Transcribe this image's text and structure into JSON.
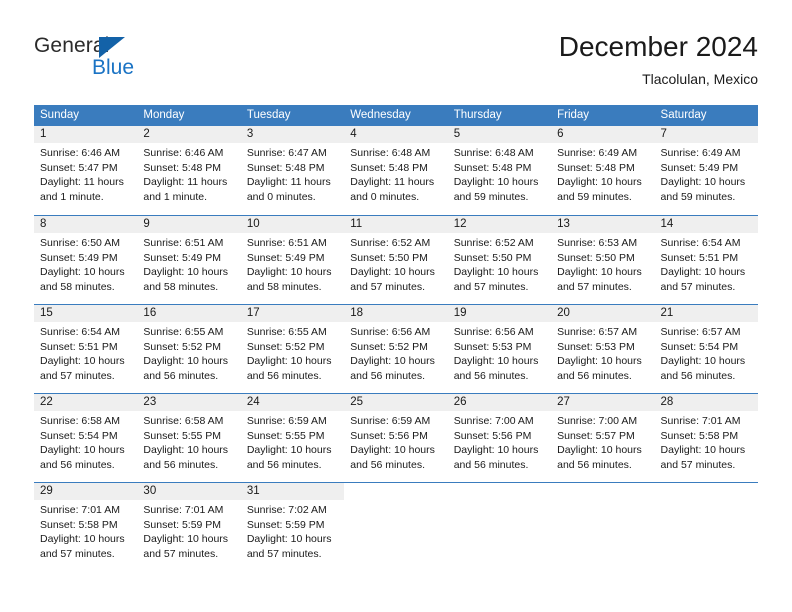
{
  "brand": {
    "name_part1": "General",
    "name_part2": "Blue",
    "triangle_color": "#1362a8",
    "blue_color": "#1a73c4"
  },
  "header": {
    "title": "December 2024",
    "subtitle": "Tlacolulan, Mexico"
  },
  "theme": {
    "header_bg": "#3a7cbe",
    "daynum_bg": "#efefef",
    "text": "#1a1a1a"
  },
  "weekdays": [
    {
      "label": "Sunday"
    },
    {
      "label": "Monday"
    },
    {
      "label": "Tuesday"
    },
    {
      "label": "Wednesday"
    },
    {
      "label": "Thursday"
    },
    {
      "label": "Friday"
    },
    {
      "label": "Saturday"
    }
  ],
  "weeks": [
    {
      "days": [
        {
          "num": "1",
          "sunrise": "Sunrise: 6:46 AM",
          "sunset": "Sunset: 5:47 PM",
          "daylight1": "Daylight: 11 hours",
          "daylight2": "and 1 minute."
        },
        {
          "num": "2",
          "sunrise": "Sunrise: 6:46 AM",
          "sunset": "Sunset: 5:48 PM",
          "daylight1": "Daylight: 11 hours",
          "daylight2": "and 1 minute."
        },
        {
          "num": "3",
          "sunrise": "Sunrise: 6:47 AM",
          "sunset": "Sunset: 5:48 PM",
          "daylight1": "Daylight: 11 hours",
          "daylight2": "and 0 minutes."
        },
        {
          "num": "4",
          "sunrise": "Sunrise: 6:48 AM",
          "sunset": "Sunset: 5:48 PM",
          "daylight1": "Daylight: 11 hours",
          "daylight2": "and 0 minutes."
        },
        {
          "num": "5",
          "sunrise": "Sunrise: 6:48 AM",
          "sunset": "Sunset: 5:48 PM",
          "daylight1": "Daylight: 10 hours",
          "daylight2": "and 59 minutes."
        },
        {
          "num": "6",
          "sunrise": "Sunrise: 6:49 AM",
          "sunset": "Sunset: 5:48 PM",
          "daylight1": "Daylight: 10 hours",
          "daylight2": "and 59 minutes."
        },
        {
          "num": "7",
          "sunrise": "Sunrise: 6:49 AM",
          "sunset": "Sunset: 5:49 PM",
          "daylight1": "Daylight: 10 hours",
          "daylight2": "and 59 minutes."
        }
      ]
    },
    {
      "days": [
        {
          "num": "8",
          "sunrise": "Sunrise: 6:50 AM",
          "sunset": "Sunset: 5:49 PM",
          "daylight1": "Daylight: 10 hours",
          "daylight2": "and 58 minutes."
        },
        {
          "num": "9",
          "sunrise": "Sunrise: 6:51 AM",
          "sunset": "Sunset: 5:49 PM",
          "daylight1": "Daylight: 10 hours",
          "daylight2": "and 58 minutes."
        },
        {
          "num": "10",
          "sunrise": "Sunrise: 6:51 AM",
          "sunset": "Sunset: 5:49 PM",
          "daylight1": "Daylight: 10 hours",
          "daylight2": "and 58 minutes."
        },
        {
          "num": "11",
          "sunrise": "Sunrise: 6:52 AM",
          "sunset": "Sunset: 5:50 PM",
          "daylight1": "Daylight: 10 hours",
          "daylight2": "and 57 minutes."
        },
        {
          "num": "12",
          "sunrise": "Sunrise: 6:52 AM",
          "sunset": "Sunset: 5:50 PM",
          "daylight1": "Daylight: 10 hours",
          "daylight2": "and 57 minutes."
        },
        {
          "num": "13",
          "sunrise": "Sunrise: 6:53 AM",
          "sunset": "Sunset: 5:50 PM",
          "daylight1": "Daylight: 10 hours",
          "daylight2": "and 57 minutes."
        },
        {
          "num": "14",
          "sunrise": "Sunrise: 6:54 AM",
          "sunset": "Sunset: 5:51 PM",
          "daylight1": "Daylight: 10 hours",
          "daylight2": "and 57 minutes."
        }
      ]
    },
    {
      "days": [
        {
          "num": "15",
          "sunrise": "Sunrise: 6:54 AM",
          "sunset": "Sunset: 5:51 PM",
          "daylight1": "Daylight: 10 hours",
          "daylight2": "and 57 minutes."
        },
        {
          "num": "16",
          "sunrise": "Sunrise: 6:55 AM",
          "sunset": "Sunset: 5:52 PM",
          "daylight1": "Daylight: 10 hours",
          "daylight2": "and 56 minutes."
        },
        {
          "num": "17",
          "sunrise": "Sunrise: 6:55 AM",
          "sunset": "Sunset: 5:52 PM",
          "daylight1": "Daylight: 10 hours",
          "daylight2": "and 56 minutes."
        },
        {
          "num": "18",
          "sunrise": "Sunrise: 6:56 AM",
          "sunset": "Sunset: 5:52 PM",
          "daylight1": "Daylight: 10 hours",
          "daylight2": "and 56 minutes."
        },
        {
          "num": "19",
          "sunrise": "Sunrise: 6:56 AM",
          "sunset": "Sunset: 5:53 PM",
          "daylight1": "Daylight: 10 hours",
          "daylight2": "and 56 minutes."
        },
        {
          "num": "20",
          "sunrise": "Sunrise: 6:57 AM",
          "sunset": "Sunset: 5:53 PM",
          "daylight1": "Daylight: 10 hours",
          "daylight2": "and 56 minutes."
        },
        {
          "num": "21",
          "sunrise": "Sunrise: 6:57 AM",
          "sunset": "Sunset: 5:54 PM",
          "daylight1": "Daylight: 10 hours",
          "daylight2": "and 56 minutes."
        }
      ]
    },
    {
      "days": [
        {
          "num": "22",
          "sunrise": "Sunrise: 6:58 AM",
          "sunset": "Sunset: 5:54 PM",
          "daylight1": "Daylight: 10 hours",
          "daylight2": "and 56 minutes."
        },
        {
          "num": "23",
          "sunrise": "Sunrise: 6:58 AM",
          "sunset": "Sunset: 5:55 PM",
          "daylight1": "Daylight: 10 hours",
          "daylight2": "and 56 minutes."
        },
        {
          "num": "24",
          "sunrise": "Sunrise: 6:59 AM",
          "sunset": "Sunset: 5:55 PM",
          "daylight1": "Daylight: 10 hours",
          "daylight2": "and 56 minutes."
        },
        {
          "num": "25",
          "sunrise": "Sunrise: 6:59 AM",
          "sunset": "Sunset: 5:56 PM",
          "daylight1": "Daylight: 10 hours",
          "daylight2": "and 56 minutes."
        },
        {
          "num": "26",
          "sunrise": "Sunrise: 7:00 AM",
          "sunset": "Sunset: 5:56 PM",
          "daylight1": "Daylight: 10 hours",
          "daylight2": "and 56 minutes."
        },
        {
          "num": "27",
          "sunrise": "Sunrise: 7:00 AM",
          "sunset": "Sunset: 5:57 PM",
          "daylight1": "Daylight: 10 hours",
          "daylight2": "and 56 minutes."
        },
        {
          "num": "28",
          "sunrise": "Sunrise: 7:01 AM",
          "sunset": "Sunset: 5:58 PM",
          "daylight1": "Daylight: 10 hours",
          "daylight2": "and 57 minutes."
        }
      ]
    },
    {
      "days": [
        {
          "num": "29",
          "sunrise": "Sunrise: 7:01 AM",
          "sunset": "Sunset: 5:58 PM",
          "daylight1": "Daylight: 10 hours",
          "daylight2": "and 57 minutes."
        },
        {
          "num": "30",
          "sunrise": "Sunrise: 7:01 AM",
          "sunset": "Sunset: 5:59 PM",
          "daylight1": "Daylight: 10 hours",
          "daylight2": "and 57 minutes."
        },
        {
          "num": "31",
          "sunrise": "Sunrise: 7:02 AM",
          "sunset": "Sunset: 5:59 PM",
          "daylight1": "Daylight: 10 hours",
          "daylight2": "and 57 minutes."
        },
        {
          "num": "",
          "sunrise": "",
          "sunset": "",
          "daylight1": "",
          "daylight2": ""
        },
        {
          "num": "",
          "sunrise": "",
          "sunset": "",
          "daylight1": "",
          "daylight2": ""
        },
        {
          "num": "",
          "sunrise": "",
          "sunset": "",
          "daylight1": "",
          "daylight2": ""
        },
        {
          "num": "",
          "sunrise": "",
          "sunset": "",
          "daylight1": "",
          "daylight2": ""
        }
      ]
    }
  ]
}
